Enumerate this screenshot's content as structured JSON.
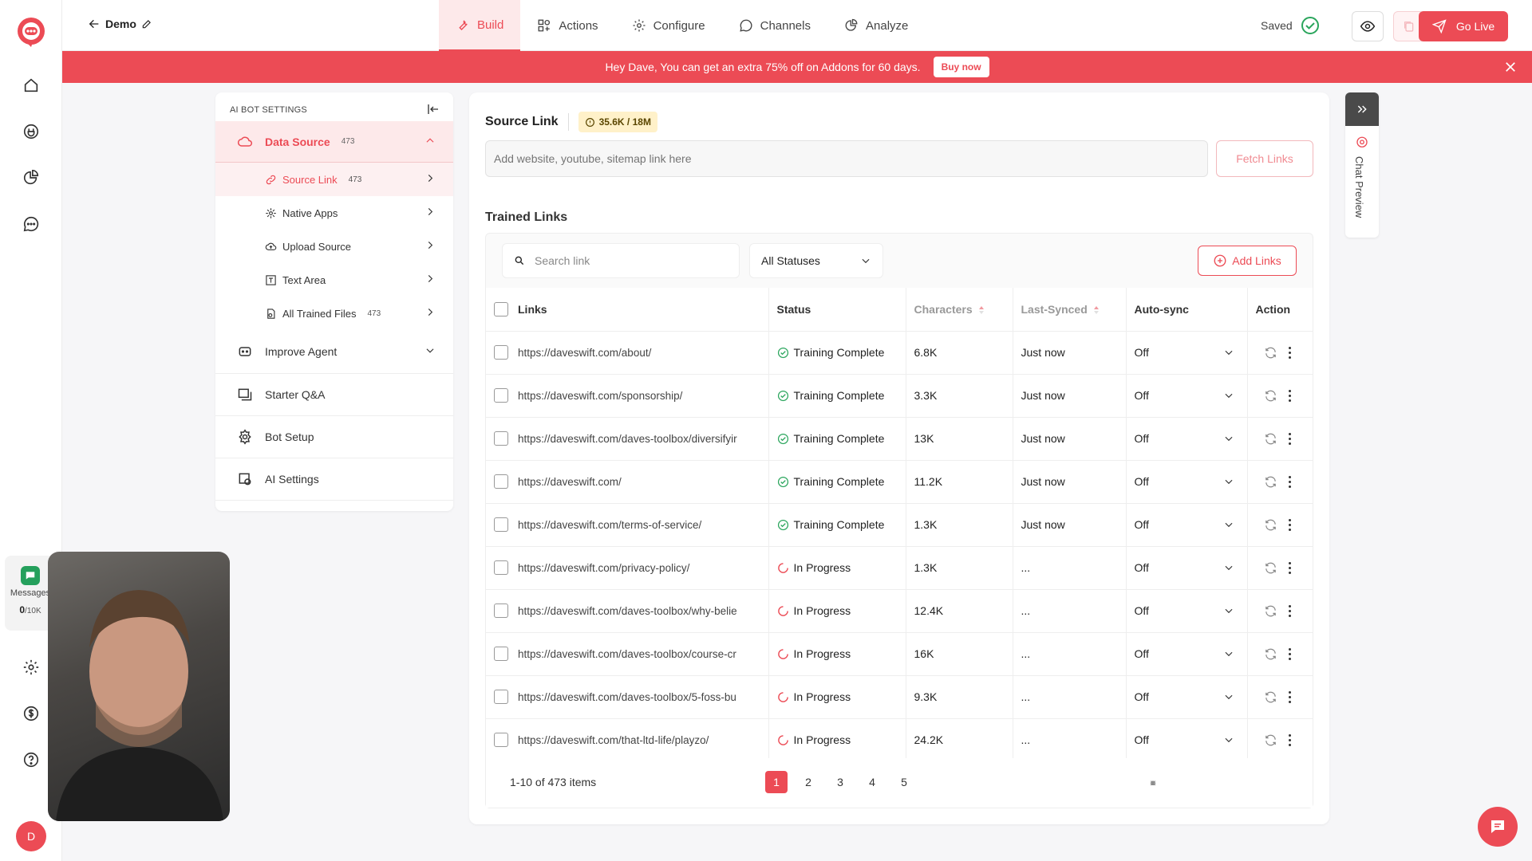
{
  "topbar": {
    "back_label": "Demo",
    "tabs": [
      {
        "label": "Build",
        "icon": "wrench-icon"
      },
      {
        "label": "Actions",
        "icon": "actions-icon"
      },
      {
        "label": "Configure",
        "icon": "gear-icon"
      },
      {
        "label": "Channels",
        "icon": "channels-icon"
      },
      {
        "label": "Analyze",
        "icon": "analytics-icon"
      }
    ],
    "active_tab": "Build",
    "saved_label": "Saved",
    "go_live_label": "Go Live"
  },
  "banner": {
    "text": "Hey Dave, You can get an extra 75% off on Addons for 60 days.",
    "button_label": "Buy now"
  },
  "rail": {
    "messages_label": "Messages",
    "messages_count": "0",
    "messages_limit": "/10K",
    "avatar_initial": "D"
  },
  "settings": {
    "header": "AI BOT SETTINGS",
    "data_source": {
      "label": "Data Source",
      "count": "473"
    },
    "sub_items": [
      {
        "label": "Source Link",
        "count": "473",
        "icon": "link-icon"
      },
      {
        "label": "Native Apps",
        "count": "",
        "icon": "apps-icon"
      },
      {
        "label": "Upload Source",
        "count": "",
        "icon": "cloud-upload-icon"
      },
      {
        "label": "Text Area",
        "count": "",
        "icon": "text-area-icon"
      },
      {
        "label": "All Trained Files",
        "count": "473",
        "icon": "files-icon"
      }
    ],
    "sections": [
      {
        "label": "Improve Agent",
        "icon": "agent-icon"
      },
      {
        "label": "Starter Q&A",
        "icon": "qa-icon"
      },
      {
        "label": "Bot Setup",
        "icon": "bot-setup-icon"
      },
      {
        "label": "AI Settings",
        "icon": "ai-settings-icon"
      }
    ]
  },
  "source": {
    "title": "Source Link",
    "quota": "35.6K / 18M",
    "input_placeholder": "Add website, youtube, sitemap link here",
    "fetch_label": "Fetch Links"
  },
  "trained": {
    "title": "Trained Links",
    "search_placeholder": "Search link",
    "status_filter": "All Statuses",
    "add_links_label": "Add Links",
    "columns": [
      "Links",
      "Status",
      "Characters",
      "Last-Synced",
      "Auto-sync",
      "Action"
    ],
    "rows": [
      {
        "link": "https://daveswift.com/about/",
        "status": "Training Complete",
        "chars": "6.8K",
        "synced": "Just now",
        "autosync": "Off"
      },
      {
        "link": "https://daveswift.com/sponsorship/",
        "status": "Training Complete",
        "chars": "3.3K",
        "synced": "Just now",
        "autosync": "Off"
      },
      {
        "link": "https://daveswift.com/daves-toolbox/diversifyir",
        "status": "Training Complete",
        "chars": "13K",
        "synced": "Just now",
        "autosync": "Off"
      },
      {
        "link": "https://daveswift.com/",
        "status": "Training Complete",
        "chars": "11.2K",
        "synced": "Just now",
        "autosync": "Off"
      },
      {
        "link": "https://daveswift.com/terms-of-service/",
        "status": "Training Complete",
        "chars": "1.3K",
        "synced": "Just now",
        "autosync": "Off"
      },
      {
        "link": "https://daveswift.com/privacy-policy/",
        "status": "In Progress",
        "chars": "1.3K",
        "synced": "...",
        "autosync": "Off"
      },
      {
        "link": "https://daveswift.com/daves-toolbox/why-belie",
        "status": "In Progress",
        "chars": "12.4K",
        "synced": "...",
        "autosync": "Off"
      },
      {
        "link": "https://daveswift.com/daves-toolbox/course-cr",
        "status": "In Progress",
        "chars": "16K",
        "synced": "...",
        "autosync": "Off"
      },
      {
        "link": "https://daveswift.com/daves-toolbox/5-foss-bu",
        "status": "In Progress",
        "chars": "9.3K",
        "synced": "...",
        "autosync": "Off"
      },
      {
        "link": "https://daveswift.com/that-ltd-life/playzo/",
        "status": "In Progress",
        "chars": "24.2K",
        "synced": "...",
        "autosync": "Off"
      }
    ],
    "pagination": {
      "summary": "1-10 of 473 items",
      "pages": [
        "1",
        "2",
        "3",
        "4",
        "5"
      ],
      "current": "1"
    }
  },
  "chat_preview_label": "Chat Preview",
  "colors": {
    "accent": "#ec4b55",
    "success": "#2aa55c",
    "banner": "#ec4b55"
  }
}
